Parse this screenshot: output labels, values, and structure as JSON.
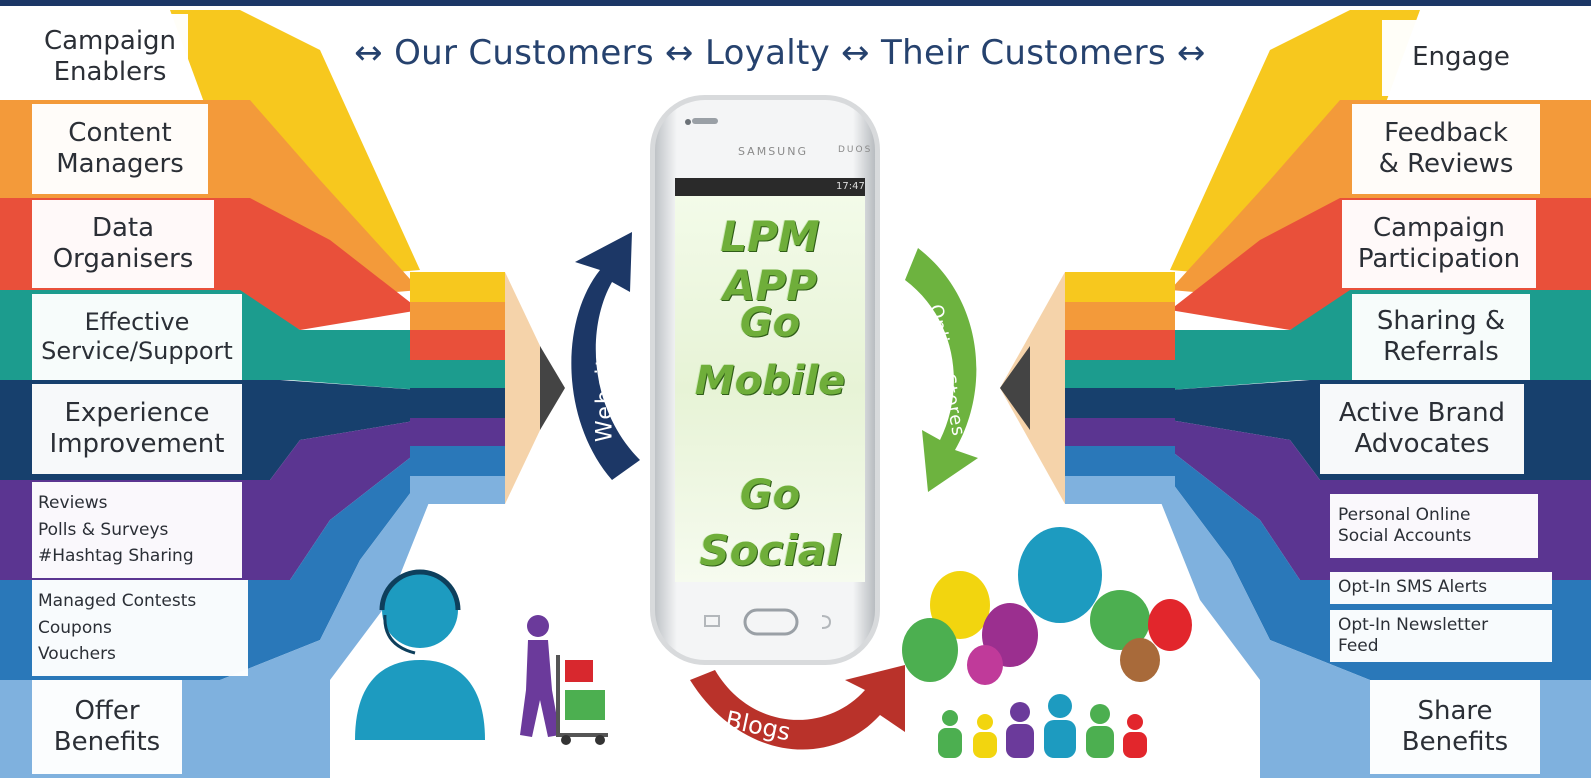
{
  "header": {
    "flow_text": "↔ Our Customers ↔ Loyalty ↔ Their Customers ↔"
  },
  "left_labels": [
    {
      "lines": [
        "Campaign",
        "Enablers"
      ]
    },
    {
      "lines": [
        "Content",
        "Managers"
      ]
    },
    {
      "lines": [
        "Data",
        "Organisers"
      ]
    },
    {
      "lines": [
        "Effective",
        "Service/Support"
      ]
    },
    {
      "lines": [
        "Experience",
        "Improvement"
      ]
    },
    {
      "lines": [
        "Reviews",
        "Polls & Surveys",
        "#Hashtag Sharing"
      ]
    },
    {
      "lines": [
        "Managed Contests",
        "Coupons",
        "Vouchers"
      ]
    },
    {
      "lines": [
        "Offer",
        "Benefits"
      ]
    }
  ],
  "right_labels": [
    {
      "lines": [
        "Engage"
      ]
    },
    {
      "lines": [
        "Feedback",
        "& Reviews"
      ]
    },
    {
      "lines": [
        "Campaign",
        "Participation"
      ]
    },
    {
      "lines": [
        "Sharing &",
        "Referrals"
      ]
    },
    {
      "lines": [
        "Active Brand",
        "Advocates"
      ]
    },
    {
      "lines": [
        "Personal Online",
        "Social Accounts"
      ]
    },
    {
      "lines": [
        "Opt-In SMS Alerts"
      ]
    },
    {
      "lines": [
        "Opt-In Newsletter",
        "Feed"
      ]
    },
    {
      "lines": [
        "Share",
        "Benefits"
      ]
    }
  ],
  "phone": {
    "brand": "SAMSUNG",
    "model": "DUOS",
    "status_time": "17:47",
    "app_title": "LPM APP",
    "line1a": "Go",
    "line1b": "Mobile",
    "line2a": "Go",
    "line2b": "Social"
  },
  "arrows": {
    "left": "Websites",
    "right": "Online Stores",
    "bottom": "Blogs"
  },
  "colors": {
    "band_colors": [
      "#f7c81e",
      "#f39a3a",
      "#e9503a",
      "#1c9c8e",
      "#17406d",
      "#5b3591",
      "#2a78b9",
      "#7fb1de"
    ],
    "navy_arrow": "#1c3766",
    "green_arrow": "#6db33f",
    "red_arrow": "#b9322a",
    "phone_text": "#6fae3a"
  },
  "icons": {
    "support_agent": "headset-person-icon",
    "delivery": "hand-truck-person-icon",
    "social_crowd": "speech-bubbles-crowd-icon"
  }
}
